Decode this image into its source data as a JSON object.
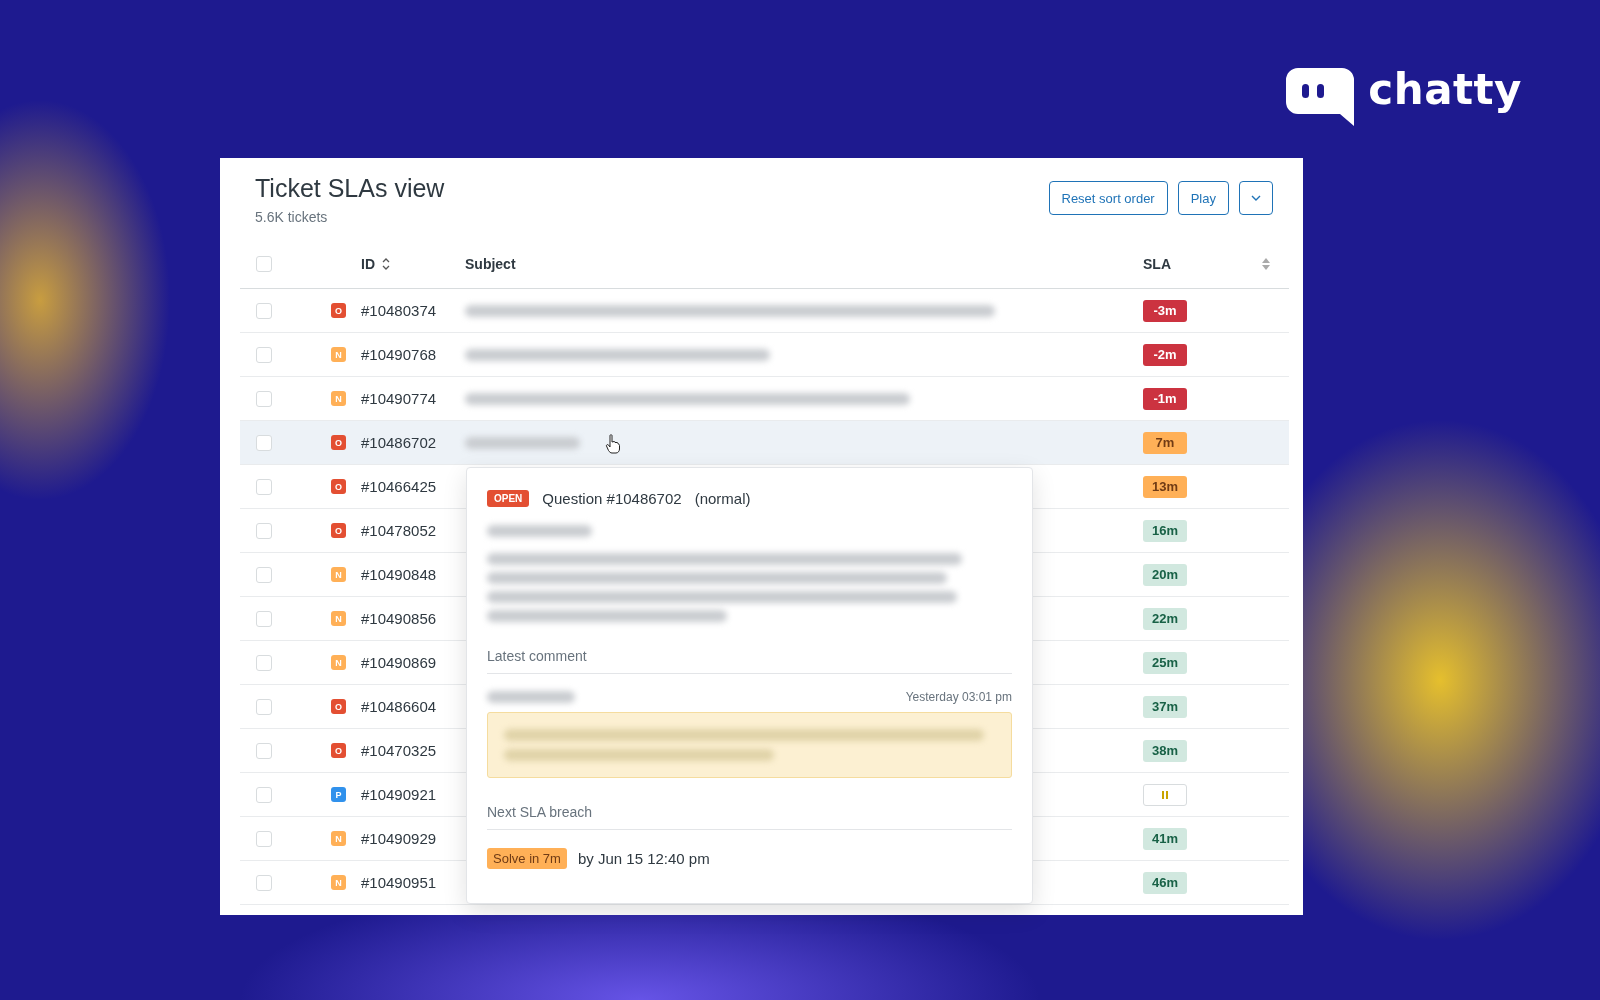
{
  "logo": {
    "text": "chatty"
  },
  "view": {
    "title": "Ticket SLAs view",
    "subtitle": "5.6K tickets"
  },
  "buttons": [
    {
      "label": "Reset sort order",
      "kind": "text"
    },
    {
      "label": "Play",
      "kind": "text"
    },
    {
      "kind": "dropdown"
    }
  ],
  "table": {
    "select_all": {
      "checked": false
    },
    "columns": [
      {
        "label": "ID",
        "sort_icon": true
      },
      {
        "label": "Subject"
      },
      {
        "label": "SLA",
        "sort_icon": true
      }
    ],
    "rows": [
      {
        "status": "O",
        "color": "#e34f32",
        "id": "#10480374",
        "sla": {
          "kind": "breached",
          "text": "-3m"
        },
        "checked": false,
        "selected": false
      },
      {
        "status": "N",
        "color": "#ffb057",
        "id": "#10490768",
        "sla": {
          "kind": "breached",
          "text": "-2m"
        },
        "checked": false,
        "selected": false
      },
      {
        "status": "N",
        "color": "#ffb057",
        "id": "#10490774",
        "sla": {
          "kind": "breached",
          "text": "-1m"
        },
        "checked": false,
        "selected": false
      },
      {
        "status": "O",
        "color": "#e34f32",
        "id": "#10486702",
        "sla": {
          "kind": "warning",
          "text": "7m"
        },
        "checked": false,
        "selected": true
      },
      {
        "status": "O",
        "color": "#e34f32",
        "id": "#10466425",
        "sla": {
          "kind": "warning",
          "text": "13m"
        },
        "checked": false,
        "selected": false
      },
      {
        "status": "O",
        "color": "#e34f32",
        "id": "#10478052",
        "sla": {
          "kind": "ok",
          "text": "16m"
        },
        "checked": false,
        "selected": false
      },
      {
        "status": "N",
        "color": "#ffb057",
        "id": "#10490848",
        "sla": {
          "kind": "ok",
          "text": "20m"
        },
        "checked": false,
        "selected": false
      },
      {
        "status": "N",
        "color": "#ffb057",
        "id": "#10490856",
        "sla": {
          "kind": "ok",
          "text": "22m"
        },
        "checked": false,
        "selected": false
      },
      {
        "status": "N",
        "color": "#ffb057",
        "id": "#10490869",
        "sla": {
          "kind": "ok",
          "text": "25m"
        },
        "checked": false,
        "selected": false
      },
      {
        "status": "O",
        "color": "#e34f32",
        "id": "#10486604",
        "sla": {
          "kind": "ok",
          "text": "37m"
        },
        "checked": false,
        "selected": false
      },
      {
        "status": "O",
        "color": "#e34f32",
        "id": "#10470325",
        "sla": {
          "kind": "ok",
          "text": "38m"
        },
        "checked": false,
        "selected": false
      },
      {
        "status": "P",
        "color": "#3091ec",
        "id": "#10490921",
        "sla": {
          "kind": "paused"
        },
        "checked": false,
        "selected": false
      },
      {
        "status": "N",
        "color": "#ffb057",
        "id": "#10490929",
        "sla": {
          "kind": "ok",
          "text": "41m"
        },
        "checked": false,
        "selected": false
      },
      {
        "status": "N",
        "color": "#ffb057",
        "id": "#10490951",
        "sla": {
          "kind": "ok",
          "text": "46m"
        },
        "checked": false,
        "selected": false
      }
    ]
  },
  "popover": {
    "status_badge": "OPEN",
    "title": "Question #10486702",
    "priority": "(normal)",
    "comment_label": "Latest comment",
    "comment_time": "Yesterday 03:01 pm",
    "breach_label": "Next SLA breach",
    "breach_badge": "Solve in 7m",
    "breach_time": "by Jun 15 12:40 pm"
  }
}
